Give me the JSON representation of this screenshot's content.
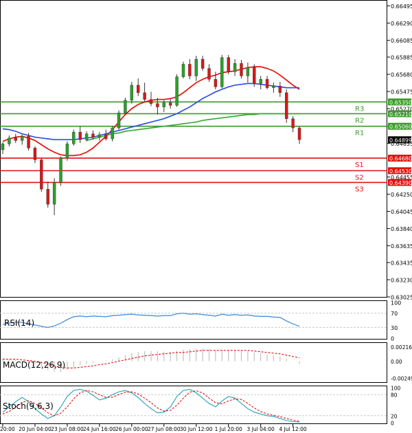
{
  "chart_data": [
    {
      "type": "candlestick",
      "panel": "price",
      "ylim": [
        0.63025,
        0.665
      ],
      "y_tick_labels": [
        "0.66495",
        "0.66290",
        "0.66085",
        "0.65885",
        "0.65680",
        "0.65475",
        "0.65270",
        "0.65060",
        "0.64855",
        "0.64455",
        "0.64250",
        "0.64045",
        "0.63840",
        "0.63635",
        "0.63435",
        "0.63230",
        "0.63025"
      ],
      "moving_averages": [
        {
          "color": "#e8100c",
          "values": [
            0.6488,
            0.6491,
            0.6493,
            0.6494,
            0.6492,
            0.6489,
            0.6484,
            0.6479,
            0.6475,
            0.6472,
            0.6471,
            0.6471,
            0.6472,
            0.6475,
            0.648,
            0.6487,
            0.6494,
            0.6502,
            0.6511,
            0.652,
            0.6527,
            0.6532,
            0.6535,
            0.6537,
            0.6538,
            0.6538,
            0.6539,
            0.6541,
            0.6546,
            0.6552,
            0.6558,
            0.6562,
            0.6565,
            0.6567,
            0.657,
            0.6571,
            0.6572,
            0.6574,
            0.6576,
            0.6577,
            0.6577,
            0.6575,
            0.6572,
            0.6567,
            0.6561,
            0.6555,
            0.655
          ]
        },
        {
          "color": "#3050e0",
          "values": [
            0.6503,
            0.6502,
            0.65,
            0.6497,
            0.6495,
            0.6493,
            0.6492,
            0.6491,
            0.649,
            0.649,
            0.649,
            0.649,
            0.6491,
            0.6492,
            0.6493,
            0.6495,
            0.6497,
            0.6499,
            0.6501,
            0.6503,
            0.6505,
            0.6507,
            0.6509,
            0.6511,
            0.6513,
            0.6515,
            0.6518,
            0.6521,
            0.6525,
            0.6529,
            0.6534,
            0.6539,
            0.6543,
            0.6547,
            0.655,
            0.6553,
            0.6555,
            0.6556,
            0.6557,
            0.6557,
            0.6556,
            0.6555,
            0.6554,
            0.6553,
            0.6552,
            0.6552,
            0.6552
          ]
        },
        {
          "color": "#3aaa3a",
          "values": [
            null,
            null,
            null,
            null,
            null,
            null,
            null,
            null,
            null,
            null,
            null,
            null,
            null,
            0.6489,
            0.6491,
            0.6493,
            0.6495,
            0.6497,
            0.6498,
            0.65,
            0.6501,
            0.6502,
            0.6503,
            0.6504,
            0.6505,
            0.6506,
            0.6507,
            0.6508,
            0.6509,
            0.651,
            0.6511,
            0.6513,
            0.6514,
            0.6515,
            0.6516,
            0.6517,
            0.6518,
            0.6519,
            0.652,
            0.652,
            0.6521,
            0.6521,
            0.6521,
            0.6521,
            0.6521,
            0.6521,
            0.6521
          ]
        }
      ],
      "candles": [
        {
          "o": 0.6478,
          "h": 0.6487,
          "l": 0.6473,
          "c": 0.6485
        },
        {
          "o": 0.6485,
          "h": 0.6495,
          "l": 0.6482,
          "c": 0.6492
        },
        {
          "o": 0.6492,
          "h": 0.6497,
          "l": 0.6486,
          "c": 0.6489
        },
        {
          "o": 0.6489,
          "h": 0.6496,
          "l": 0.6484,
          "c": 0.6494
        },
        {
          "o": 0.6494,
          "h": 0.6498,
          "l": 0.6477,
          "c": 0.648
        },
        {
          "o": 0.648,
          "h": 0.6482,
          "l": 0.6462,
          "c": 0.6466
        },
        {
          "o": 0.6466,
          "h": 0.6468,
          "l": 0.6428,
          "c": 0.6431
        },
        {
          "o": 0.6431,
          "h": 0.644,
          "l": 0.6409,
          "c": 0.6413
        },
        {
          "o": 0.6413,
          "h": 0.6444,
          "l": 0.64,
          "c": 0.6439
        },
        {
          "o": 0.6439,
          "h": 0.647,
          "l": 0.6435,
          "c": 0.6468
        },
        {
          "o": 0.6468,
          "h": 0.6488,
          "l": 0.6465,
          "c": 0.6485
        },
        {
          "o": 0.6485,
          "h": 0.6502,
          "l": 0.6483,
          "c": 0.6499
        },
        {
          "o": 0.6499,
          "h": 0.6506,
          "l": 0.6486,
          "c": 0.649
        },
        {
          "o": 0.649,
          "h": 0.65,
          "l": 0.6488,
          "c": 0.6497
        },
        {
          "o": 0.6497,
          "h": 0.6501,
          "l": 0.649,
          "c": 0.6493
        },
        {
          "o": 0.6493,
          "h": 0.6499,
          "l": 0.6489,
          "c": 0.6496
        },
        {
          "o": 0.6496,
          "h": 0.6502,
          "l": 0.6489,
          "c": 0.6491
        },
        {
          "o": 0.6491,
          "h": 0.6506,
          "l": 0.6488,
          "c": 0.6504
        },
        {
          "o": 0.6504,
          "h": 0.6525,
          "l": 0.6502,
          "c": 0.6522
        },
        {
          "o": 0.6522,
          "h": 0.654,
          "l": 0.652,
          "c": 0.6537
        },
        {
          "o": 0.6537,
          "h": 0.6559,
          "l": 0.6533,
          "c": 0.6555
        },
        {
          "o": 0.6555,
          "h": 0.6563,
          "l": 0.6542,
          "c": 0.6546
        },
        {
          "o": 0.6546,
          "h": 0.6558,
          "l": 0.6535,
          "c": 0.6538
        },
        {
          "o": 0.6538,
          "h": 0.6547,
          "l": 0.653,
          "c": 0.6533
        },
        {
          "o": 0.6533,
          "h": 0.654,
          "l": 0.652,
          "c": 0.6529
        },
        {
          "o": 0.6529,
          "h": 0.6537,
          "l": 0.6523,
          "c": 0.6534
        },
        {
          "o": 0.6534,
          "h": 0.6539,
          "l": 0.6527,
          "c": 0.6531
        },
        {
          "o": 0.6531,
          "h": 0.6568,
          "l": 0.6529,
          "c": 0.6565
        },
        {
          "o": 0.6565,
          "h": 0.6583,
          "l": 0.6563,
          "c": 0.658
        },
        {
          "o": 0.658,
          "h": 0.6586,
          "l": 0.6562,
          "c": 0.6566
        },
        {
          "o": 0.6566,
          "h": 0.659,
          "l": 0.656,
          "c": 0.6586
        },
        {
          "o": 0.6586,
          "h": 0.659,
          "l": 0.6572,
          "c": 0.6575
        },
        {
          "o": 0.6575,
          "h": 0.658,
          "l": 0.6559,
          "c": 0.6562
        },
        {
          "o": 0.6562,
          "h": 0.6571,
          "l": 0.655,
          "c": 0.6553
        },
        {
          "o": 0.6553,
          "h": 0.6591,
          "l": 0.6551,
          "c": 0.6588
        },
        {
          "o": 0.6588,
          "h": 0.6591,
          "l": 0.6568,
          "c": 0.6571
        },
        {
          "o": 0.6571,
          "h": 0.6586,
          "l": 0.6566,
          "c": 0.6581
        },
        {
          "o": 0.6581,
          "h": 0.6585,
          "l": 0.6563,
          "c": 0.6566
        },
        {
          "o": 0.6566,
          "h": 0.6582,
          "l": 0.6558,
          "c": 0.6576
        },
        {
          "o": 0.6576,
          "h": 0.658,
          "l": 0.6553,
          "c": 0.6557
        },
        {
          "o": 0.6557,
          "h": 0.6566,
          "l": 0.655,
          "c": 0.6562
        },
        {
          "o": 0.6562,
          "h": 0.6566,
          "l": 0.655,
          "c": 0.6552
        },
        {
          "o": 0.6552,
          "h": 0.6558,
          "l": 0.6546,
          "c": 0.6554
        },
        {
          "o": 0.6554,
          "h": 0.6559,
          "l": 0.6541,
          "c": 0.6546
        },
        {
          "o": 0.6546,
          "h": 0.655,
          "l": 0.651,
          "c": 0.6515
        },
        {
          "o": 0.6515,
          "h": 0.6518,
          "l": 0.6499,
          "c": 0.6504
        },
        {
          "o": 0.6504,
          "h": 0.6506,
          "l": 0.6485,
          "c": 0.649
        }
      ],
      "levels": [
        {
          "name": "R3",
          "value": 0.6535,
          "label": "0.65350",
          "color": "#3a9a2a"
        },
        {
          "name": "R2",
          "value": 0.6521,
          "label": "0.65210",
          "color": "#3a9a2a"
        },
        {
          "name": "R1",
          "value": 0.6506,
          "label": "0.65060",
          "color": "#3a9a2a"
        },
        {
          "name": "S1",
          "value": 0.6468,
          "label": "0.64680",
          "color": "#e01010"
        },
        {
          "name": "S2",
          "value": 0.6453,
          "label": "0.64530",
          "color": "#e01010"
        },
        {
          "name": "S3",
          "value": 0.6439,
          "label": "0.64390",
          "color": "#e01010"
        }
      ],
      "current_price": {
        "value": 0.64899,
        "label": "0.64899"
      }
    },
    {
      "type": "line",
      "panel": "rsi",
      "title": "RSI(14)",
      "ylim": [
        0,
        100
      ],
      "y_tick_labels": [
        "100",
        "70",
        "30",
        "0"
      ],
      "levels": [
        70,
        30
      ],
      "color": "#4a90d8",
      "values": [
        38,
        42,
        45,
        44,
        40,
        37,
        33,
        30,
        34,
        42,
        52,
        60,
        62,
        60,
        62,
        61,
        60,
        63,
        64,
        66,
        67,
        65,
        64,
        63,
        62,
        63,
        63,
        68,
        70,
        67,
        68,
        66,
        64,
        62,
        67,
        64,
        66,
        64,
        65,
        62,
        61,
        61,
        59,
        58,
        48,
        40,
        33
      ]
    },
    {
      "type": "bar",
      "panel": "macd",
      "title": "MACD(12,26,9)",
      "ylim": [
        -0.003,
        0.0025
      ],
      "y_tick_labels": [
        "0.002164",
        "0.00",
        "-0.002497"
      ],
      "histogram": {
        "color": "#c0c0c0",
        "values": [
          0.0004,
          0.0003,
          0.0002,
          0.0001,
          -0.0001,
          -0.0004,
          -0.0008,
          -0.0013,
          -0.0016,
          -0.0016,
          -0.0013,
          -0.0009,
          -0.0006,
          -0.0004,
          -0.0002,
          0.0,
          0.0001,
          0.0003,
          0.0006,
          0.0009,
          0.0012,
          0.0014,
          0.0015,
          0.0015,
          0.0015,
          0.0014,
          0.0014,
          0.0015,
          0.0017,
          0.0018,
          0.0019,
          0.0019,
          0.0018,
          0.0016,
          0.0017,
          0.0016,
          0.0016,
          0.0015,
          0.0015,
          0.0013,
          0.0012,
          0.001,
          0.0009,
          0.0007,
          0.0004,
          0.0,
          -0.0004
        ]
      },
      "signal": {
        "color": "#e01010",
        "values": [
          0.0003,
          0.0003,
          0.0003,
          0.0002,
          0.0001,
          0.0,
          -0.0002,
          -0.0004,
          -0.0007,
          -0.0009,
          -0.001,
          -0.001,
          -0.0009,
          -0.0008,
          -0.0007,
          -0.0005,
          -0.0004,
          -0.0002,
          0.0,
          0.0002,
          0.0004,
          0.0006,
          0.0008,
          0.0009,
          0.001,
          0.0011,
          0.0012,
          0.0013,
          0.0013,
          0.0014,
          0.0015,
          0.0016,
          0.0016,
          0.0016,
          0.0016,
          0.0016,
          0.0016,
          0.0016,
          0.0016,
          0.0015,
          0.0014,
          0.0013,
          0.0012,
          0.0011,
          0.0009,
          0.0007,
          0.0005
        ]
      }
    },
    {
      "type": "line",
      "panel": "stoch",
      "title": "Stoch(9,6,3)",
      "ylim": [
        0,
        100
      ],
      "y_tick_labels": [
        "100",
        "80",
        "20",
        "0"
      ],
      "levels": [
        80,
        20
      ],
      "series": [
        {
          "color": "#20a0b0",
          "values": [
            30,
            45,
            60,
            72,
            60,
            40,
            25,
            12,
            20,
            45,
            75,
            92,
            95,
            90,
            78,
            65,
            70,
            80,
            88,
            92,
            85,
            72,
            55,
            40,
            28,
            30,
            45,
            75,
            92,
            95,
            85,
            70,
            55,
            45,
            62,
            75,
            70,
            55,
            40,
            30,
            25,
            20,
            18,
            12,
            6,
            3,
            2
          ]
        },
        {
          "color": "#e01010",
          "values": [
            25,
            32,
            45,
            58,
            63,
            55,
            42,
            28,
            20,
            27,
            45,
            68,
            85,
            92,
            88,
            80,
            72,
            73,
            80,
            87,
            88,
            82,
            70,
            57,
            42,
            33,
            35,
            50,
            70,
            87,
            91,
            85,
            70,
            57,
            54,
            62,
            68,
            66,
            55,
            42,
            32,
            25,
            21,
            17,
            12,
            7,
            4
          ]
        }
      ]
    }
  ],
  "x_axis": {
    "labels": [
      "20:00",
      "20 Jun 04:00",
      "23 Jun 08:00",
      "24 Jun 16:00",
      "26 Jun 00:00",
      "27 Jun 08:00",
      "30 Jun 12:00",
      "1 Jul 20:00",
      "3 Jul 04:00",
      "4 Jul 12:00"
    ],
    "label_slots": [
      0,
      5,
      10,
      15,
      20,
      25,
      30,
      35,
      40,
      45
    ]
  }
}
